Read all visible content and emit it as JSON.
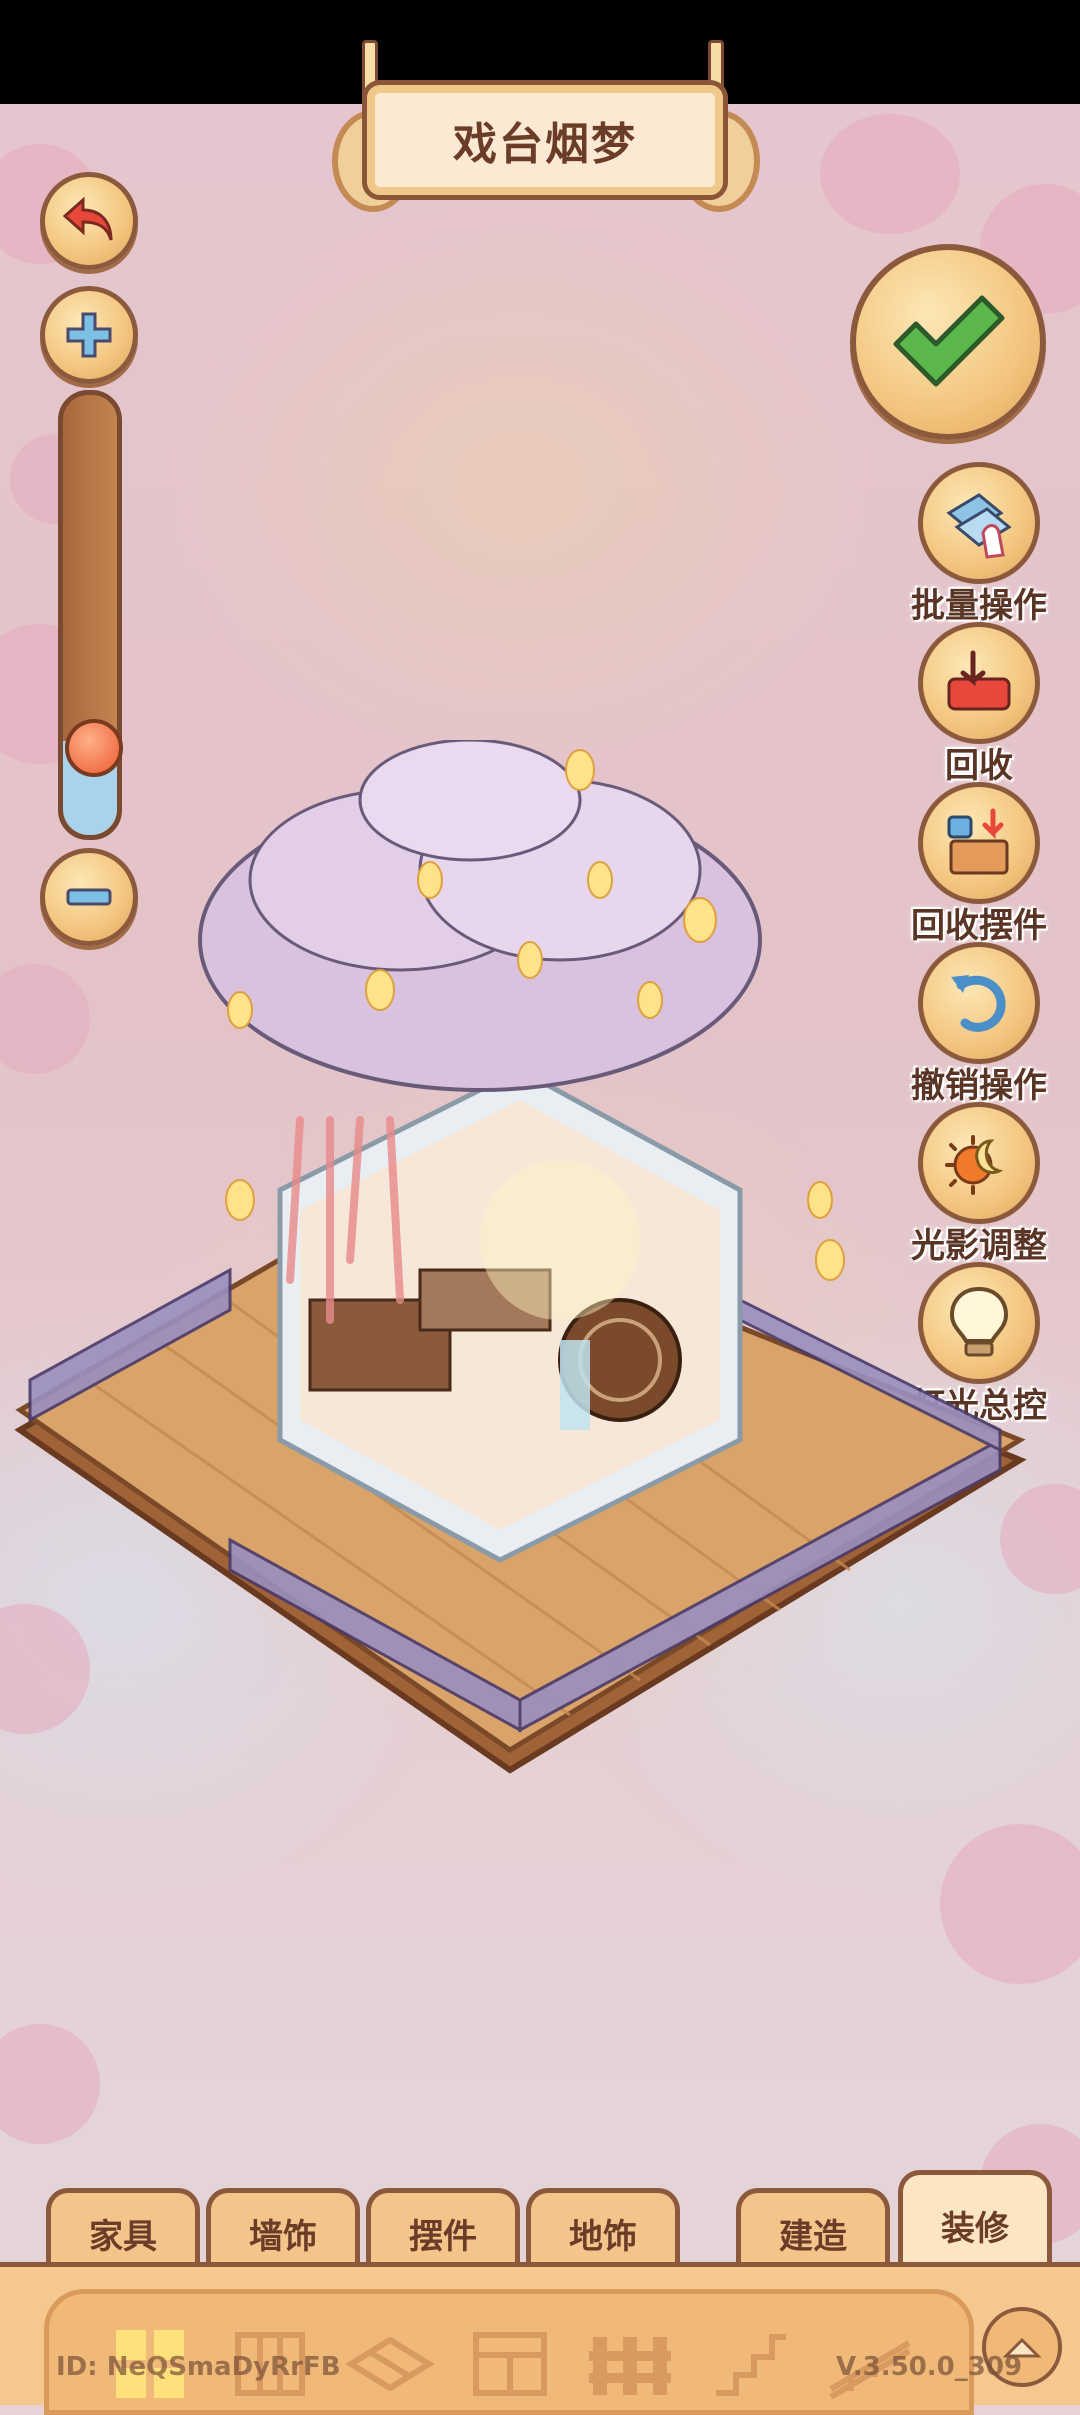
{
  "title": "戏台烟梦",
  "left_controls": {
    "back_icon": "back-arrow-icon",
    "zoom_in_icon": "plus-icon",
    "zoom_out_icon": "minus-icon",
    "zoom_level": 0.15
  },
  "confirm_icon": "checkmark-icon",
  "tools": [
    {
      "label": "批量操作",
      "icon": "batch-hand-icon"
    },
    {
      "label": "回收",
      "icon": "recycle-tray-icon"
    },
    {
      "label": "回收摆件",
      "icon": "recycle-box-icon"
    },
    {
      "label": "撤销操作",
      "icon": "undo-icon"
    },
    {
      "label": "光影调整",
      "icon": "sun-moon-icon"
    },
    {
      "label": "灯光总控",
      "icon": "lightbulb-icon"
    }
  ],
  "tabs": [
    {
      "label": "家具"
    },
    {
      "label": "墙饰"
    },
    {
      "label": "摆件"
    },
    {
      "label": "地饰"
    },
    {
      "label": "建造"
    },
    {
      "label": "装修",
      "active": true
    }
  ],
  "toolbar_icons": [
    "grid-icon",
    "wall-panel-icon",
    "floor-tile-icon",
    "window-icon",
    "fence-icon",
    "stairs-icon",
    "railing-icon"
  ],
  "collapse_icon": "chevron-up-icon",
  "footer": {
    "id": "ID: NeQSmaDyRrFB",
    "version": "V.3.50.0_309"
  },
  "colors": {
    "accent": "#f3c57e",
    "outline": "#8b5a3c",
    "check_green": "#5cb84a",
    "slider_knob": "#ec5b2e"
  }
}
